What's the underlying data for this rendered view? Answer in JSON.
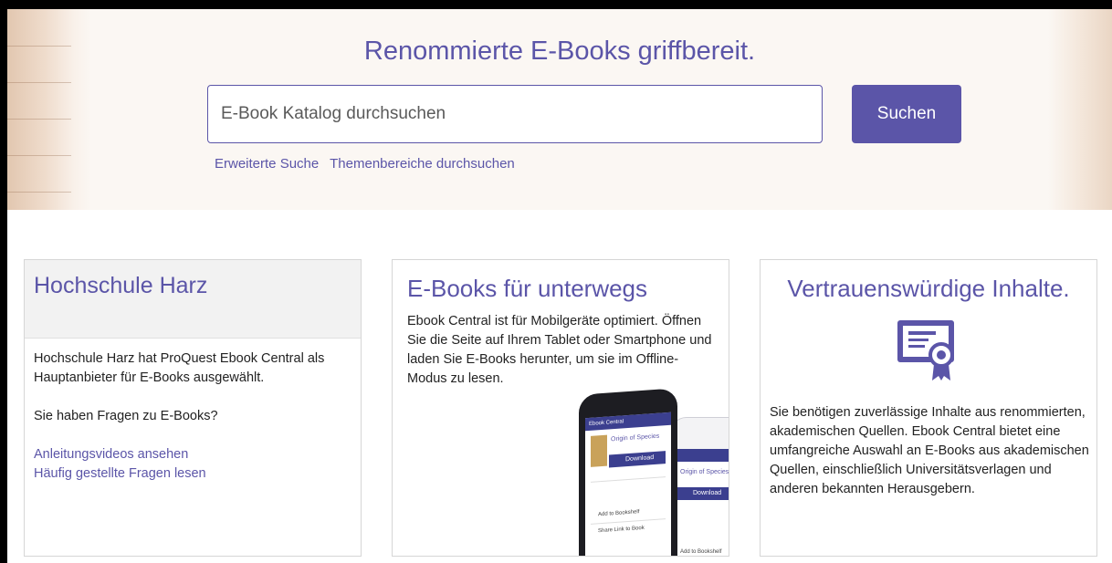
{
  "hero": {
    "title": "Renommierte E-Books griffbereit.",
    "search_placeholder": "E-Book Katalog durchsuchen",
    "search_button": "Suchen",
    "links": [
      "Erweiterte Suche",
      "Themenbereiche durchsuchen"
    ]
  },
  "cards": [
    {
      "title": "Hochschule Harz",
      "text": "Hochschule Harz hat ProQuest Ebook Central als Hauptanbieter für E-Books ausgewählt.",
      "question": "Sie haben Fragen zu E-Books?",
      "links": [
        "Anleitungsvideos ansehen",
        "Häufig gestellte Fragen lesen"
      ]
    },
    {
      "title": "E-Books für unterwegs",
      "text": "Ebook Central ist für Mobilgeräte optimiert. Öffnen Sie die Seite auf Ihrem Tablet oder Smartphone und laden Sie E-Books herunter, um sie im Offline-Modus zu lesen.",
      "illustration": {
        "header": "Ebook Central",
        "book_title": "Origin of Species",
        "download": "Download",
        "menu": [
          "Add to Bookshelf",
          "Share Link to Book"
        ]
      }
    },
    {
      "title": "Vertrauenswürdige Inhalte.",
      "icon": "certificate-icon",
      "text": "Sie benötigen zuverlässige Inhalte aus renommierten, akademischen Quellen. Ebook Central bietet eine umfangreiche Auswahl an E-Books aus akademischen Quellen, einschließlich Universitätsverlagen und anderen bekannten Herausgebern."
    }
  ],
  "colors": {
    "accent": "#5b55a8",
    "card_header_bg": "#f2f2f2"
  }
}
